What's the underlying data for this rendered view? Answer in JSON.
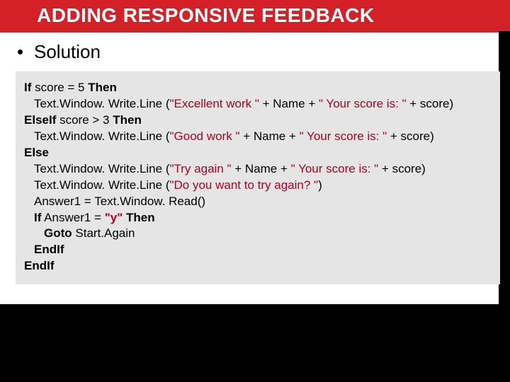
{
  "title": "ADDING RESPONSIVE FEEDBACK",
  "bullet": "Solution",
  "code": {
    "l1a": "If",
    "l1b": " score = 5 ",
    "l1c": "Then",
    "l2a": "Text.Window. Write.Line (",
    "l2b": "\"Excellent work \"",
    "l2c": " + Name + ",
    "l2d": "\" Your score is: \"",
    "l2e": " + score)",
    "l3a": "ElseIf",
    "l3b": " score > 3 ",
    "l3c": "Then",
    "l4a": "Text.Window. Write.Line (",
    "l4b": "\"Good work \"",
    "l4c": " + Name + ",
    "l4d": "\" Your score is: \"",
    "l4e": " + score)",
    "l5a": "Else",
    "l6a": "Text.Window. Write.Line (",
    "l6b": "\"Try again \"",
    "l6c": " + Name + ",
    "l6d": "\" Your score is: \"",
    "l6e": " + score)",
    "l7a": "Text.Window. Write.Line (",
    "l7b": "\"Do you want to try again? \"",
    "l7c": ")",
    "l8a": "Answer1 = Text.Window. Read()",
    "l9a": "If",
    "l9b": " Answer1 = ",
    "l9c": "\"y\"",
    "l9d": " ",
    "l9e": "Then",
    "l10a": "Goto",
    "l10b": " Start.Again",
    "l11a": "EndIf",
    "l12a": "EndIf"
  }
}
